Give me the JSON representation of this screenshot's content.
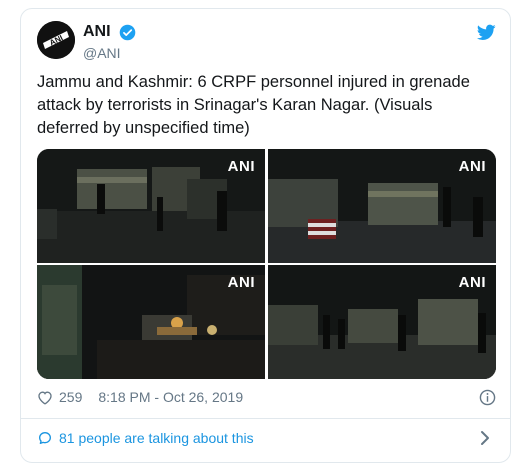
{
  "author": {
    "name": "ANI",
    "handle": "@ANI",
    "avatar_text": "ANI"
  },
  "tweet": {
    "text": "Jammu and Kashmir: 6 CRPF personnel injured in grenade attack by terrorists in Srinagar's Karan Nagar. (Visuals deferred by unspecified time)"
  },
  "media": {
    "watermarks": [
      "ANI",
      "ANI",
      "ANI",
      "ANI"
    ]
  },
  "meta": {
    "likes": "259",
    "timestamp": "8:18 PM - Oct 26, 2019"
  },
  "footer": {
    "talking": "81 people are talking about this"
  },
  "colors": {
    "link": "#1b95e0",
    "twitter_blue": "#1da1f2",
    "muted": "#657786"
  },
  "icons": [
    "verified-icon",
    "twitter-bird-icon",
    "heart-icon",
    "info-icon",
    "comment-bubble-icon",
    "chevron-right-icon"
  ]
}
